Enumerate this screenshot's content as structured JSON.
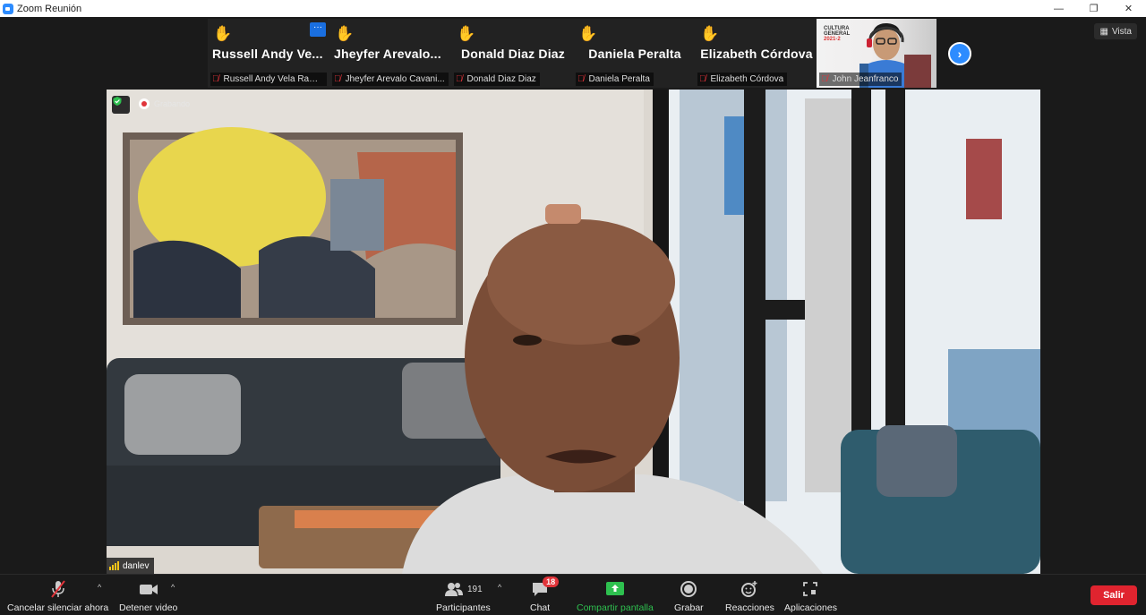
{
  "window": {
    "title": "Zoom Reunión",
    "minimize": "—",
    "restore": "❐",
    "close": "✕"
  },
  "thumbnails": [
    {
      "display_name": "Russell  Andy  Ve...",
      "label": "Russell Andy Vela Ram...",
      "hand": "✋",
      "has_more": true,
      "more_label": "···"
    },
    {
      "display_name": "Jheyfer  Arevalo...",
      "label": "Jheyfer Arevalo Cavani...",
      "hand": "✋",
      "has_more": false
    },
    {
      "display_name": "Donald Diaz Diaz",
      "label": "Donald Diaz Diaz",
      "hand": "✋",
      "has_more": false
    },
    {
      "display_name": "Daniela Peralta",
      "label": "Daniela Peralta",
      "hand": "✋",
      "has_more": false
    },
    {
      "display_name": "Elizabeth Córdova",
      "label": "Elizabeth Córdova",
      "hand": "✋",
      "has_more": false
    }
  ],
  "video_thumbnail": {
    "banner_line1": "CULTURA",
    "banner_line2": "GENERAL",
    "banner_line3": "2021-2",
    "label": "John Jeanfranco"
  },
  "next_page": "›",
  "view_button": {
    "icon": "grid-icon",
    "label": "Vista"
  },
  "speaker": {
    "recording_label": "Grabando",
    "name": "danlev"
  },
  "toolbar": {
    "mute_label": "Cancelar silenciar ahora",
    "video_label": "Detener video",
    "participants_label": "Participantes",
    "participants_count": "191",
    "chat_label": "Chat",
    "chat_badge": "18",
    "share_label": "Compartir pantalla",
    "record_label": "Grabar",
    "reactions_label": "Reacciones",
    "apps_label": "Aplicaciones",
    "leave_label": "Salir",
    "caret": "^"
  },
  "colors": {
    "accent": "#2d8cff",
    "leave": "#e0242f",
    "share": "#2ec04f",
    "muted_mic": "#e0343a",
    "raised_hand": "#f5c518"
  }
}
